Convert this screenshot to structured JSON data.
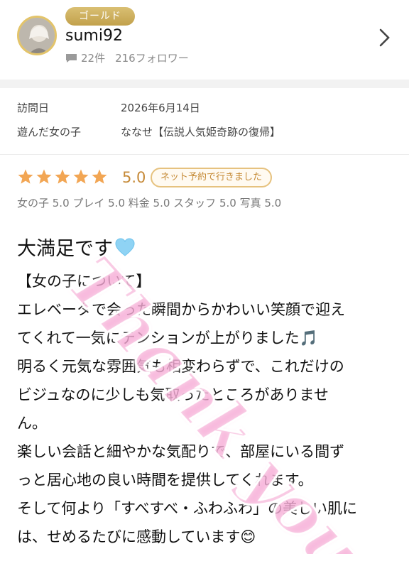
{
  "profile": {
    "rank_badge": "ゴールド",
    "username": "sumi92",
    "review_count": "22件",
    "followers": "216フォロワー"
  },
  "visit": {
    "date_label": "訪問日",
    "date_value": "2026年6月14日",
    "girl_label": "遊んだ女の子",
    "girl_value": "ななせ【伝説人気姫奇跡の復帰】"
  },
  "rating": {
    "stars": 5,
    "score": "5.0",
    "booking_tag": "ネット予約で行きました",
    "subscores": "女の子 5.0 プレイ 5.0 料金 5.0 スタッフ 5.0 写真 5.0"
  },
  "review": {
    "title": "大満足です",
    "lines": [
      "【女の子について】",
      "エレベータで会った瞬間からかわいい笑顔で迎え",
      "てくれて一気にテンションが上がりました🎵",
      "明るく元気な雰囲気も相変わらずで、これだけの",
      "ビジュなのに少しも気取ったところがありませ",
      "ん。",
      "楽しい会話と細やかな気配りで、部屋にいる間ず",
      "っと居心地の良い時間を提供してくれます。",
      "そして何より「すべすべ・ふわふわ」の美しい肌に",
      "は、せめるたびに感動しています😊"
    ]
  },
  "overlay": {
    "watermark_text": "Thank you"
  },
  "colors": {
    "gold": "#c68a38",
    "star": "#f2a654",
    "badge": "#d2b563",
    "watermark": "#f48fc9"
  },
  "icons": {
    "comment": "comment-icon",
    "chevron": "chevron-right-icon",
    "star": "star-icon",
    "heart": "heart-icon"
  }
}
